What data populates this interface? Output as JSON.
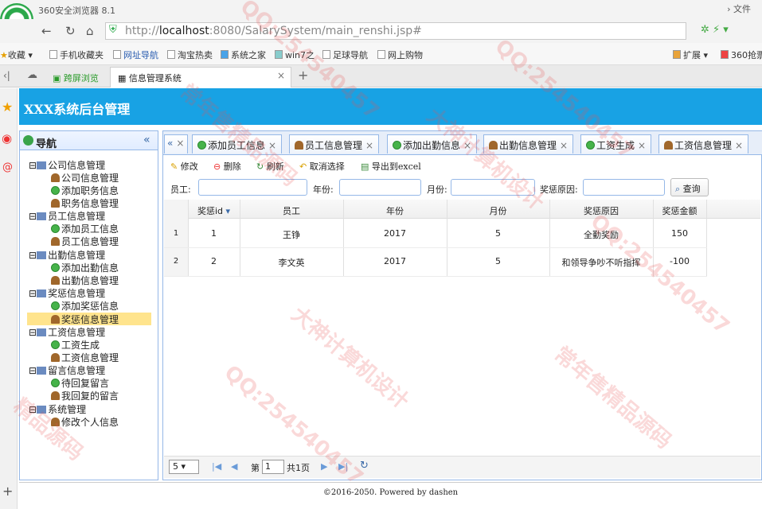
{
  "browser": {
    "name": "360安全浏览器 8.1",
    "file_menu": "文件",
    "url_prefix": "http://",
    "url_host": "localhost",
    "url_rest": ":8080/SalarySystem/main_renshi.jsp#",
    "bookmarks": [
      "收藏",
      "手机收藏夹",
      "网址导航",
      "淘宝热卖",
      "系统之家",
      "win7之",
      "足球导航",
      "网上购物"
    ],
    "ext_label": "扩展",
    "ext_label2": "360抢票",
    "tab_left": "跨屏浏览",
    "tab_active": "信息管理系统"
  },
  "app": {
    "title": "XXX系统后台管理",
    "footer": "©2016-2050. Powered by dashen"
  },
  "sidebar": {
    "title": "导航",
    "groups": [
      {
        "label": "公司信息管理",
        "items": [
          "公司信息管理",
          "添加职务信息",
          "职务信息管理"
        ]
      },
      {
        "label": "员工信息管理",
        "items": [
          "添加员工信息",
          "员工信息管理"
        ]
      },
      {
        "label": "出勤信息管理",
        "items": [
          "添加出勤信息",
          "出勤信息管理"
        ]
      },
      {
        "label": "奖惩信息管理",
        "items": [
          "添加奖惩信息",
          "奖惩信息管理"
        ]
      },
      {
        "label": "工资信息管理",
        "items": [
          "工资生成",
          "工资信息管理"
        ]
      },
      {
        "label": "留言信息管理",
        "items": [
          "待回复留言",
          "我回复的留言"
        ]
      },
      {
        "label": "系统管理",
        "items": [
          "修改个人信息"
        ]
      }
    ]
  },
  "tabs": [
    "添加员工信息",
    "员工信息管理",
    "添加出勤信息",
    "出勤信息管理",
    "工资生成",
    "工资信息管理"
  ],
  "toolbar": {
    "edit": "修改",
    "delete": "删除",
    "refresh": "刷新",
    "unselect": "取消选择",
    "export": "导出到excel"
  },
  "search": {
    "employee": "员工:",
    "year": "年份:",
    "month": "月份:",
    "reason": "奖惩原因:",
    "button": "查询"
  },
  "grid": {
    "headers": [
      "奖惩id",
      "员工",
      "年份",
      "月份",
      "奖惩原因",
      "奖惩金额"
    ],
    "rows": [
      {
        "rownum": "1",
        "id": "1",
        "employee": "王铮",
        "year": "2017",
        "month": "5",
        "reason": "全勤奖励",
        "amount": "150"
      },
      {
        "rownum": "2",
        "id": "2",
        "employee": "李文英",
        "year": "2017",
        "month": "5",
        "reason": "和领导争吵不听指挥",
        "amount": "-100"
      }
    ]
  },
  "pager": {
    "page_size": "5",
    "page_label_before": "第",
    "page_value": "1",
    "page_label_after": "共1页"
  },
  "watermarks": [
    "QQ:254540457",
    "大神计算机设计",
    "常年售精品源码",
    "QQ:254540457",
    "大神计算机设计",
    "QQ:254540457",
    "常年售精品源码",
    "精品源码",
    "QQ:254540457"
  ]
}
